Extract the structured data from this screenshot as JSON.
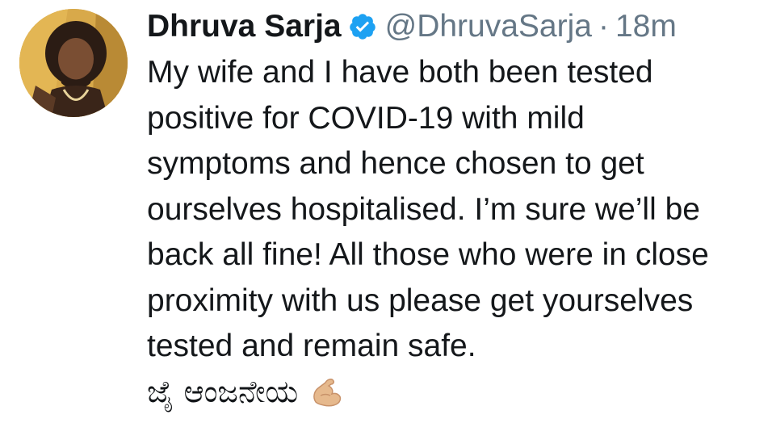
{
  "tweet": {
    "author": {
      "display_name": "Dhruva Sarja",
      "handle": "@DhruvaSarja",
      "verified": true,
      "avatar_icon": "profile-photo"
    },
    "separator": "·",
    "timestamp": "18m",
    "text": "My wife and I have both been tested\npositive for COVID-19 with mild\nsymptoms and hence chosen to get\nourselves hospitalised. I’m sure we’ll be\nback all fine! All those who were in close\nproximity with us please get yourselves\ntested and remain safe.",
    "kannada_text": "ಜೈ ಆಂಜನೇಯ",
    "emoji_icon": "flexed-biceps-icon"
  },
  "colors": {
    "text": "#14171a",
    "muted": "#657786",
    "verified": "#1da1f2"
  }
}
